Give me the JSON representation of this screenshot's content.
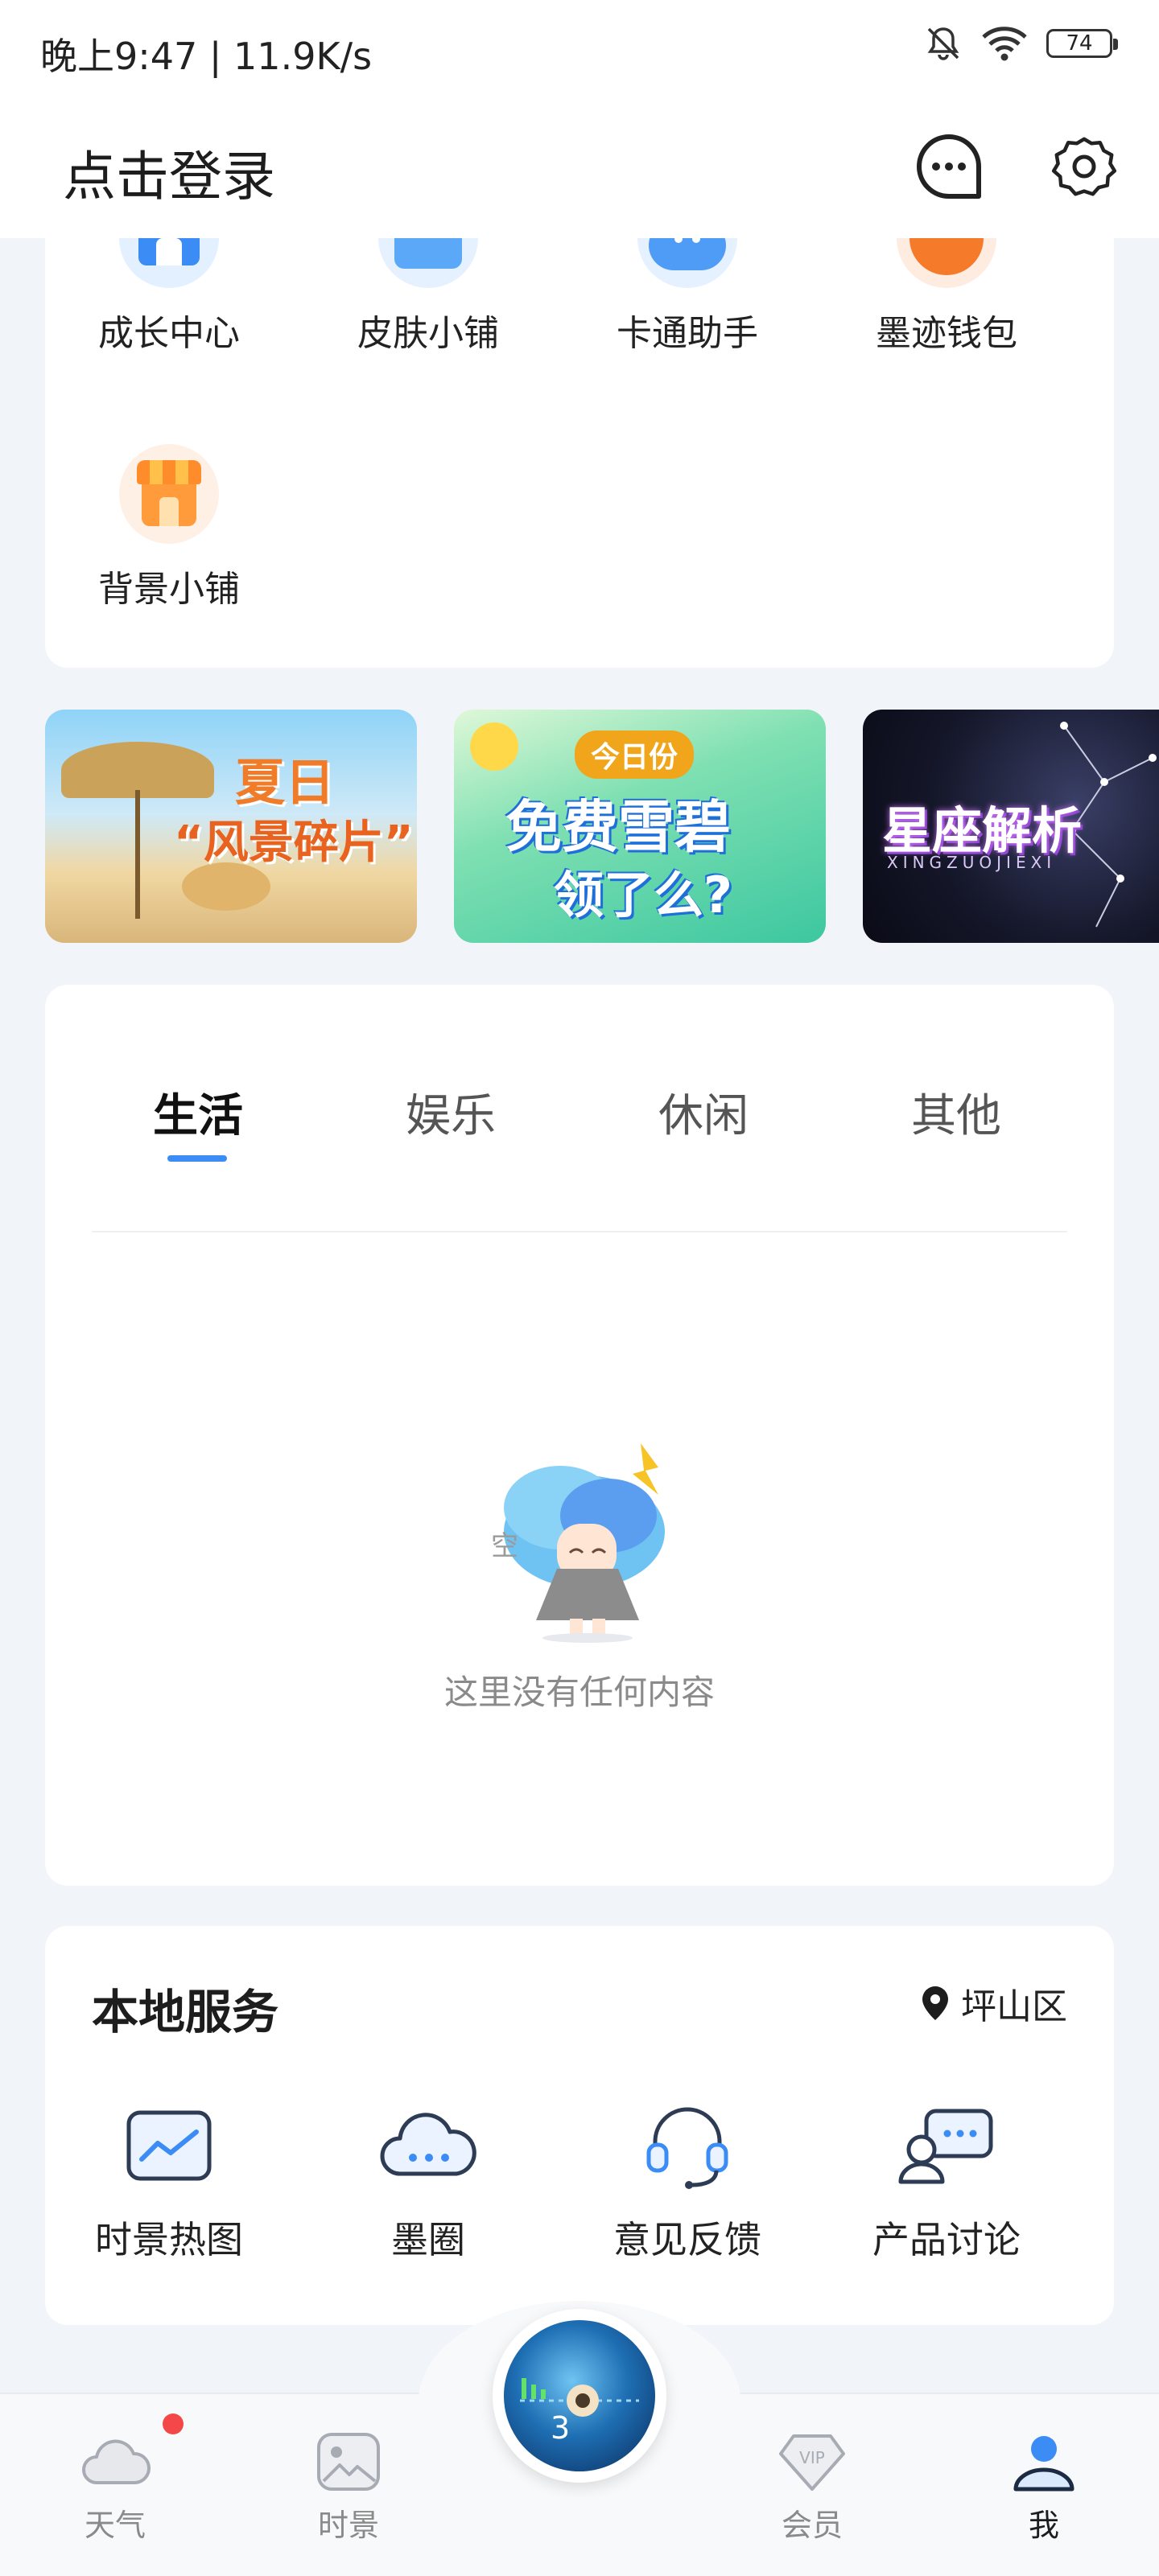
{
  "status_bar": {
    "time": "晚上9:47 | 11.9K/s",
    "battery": "74"
  },
  "header": {
    "login": "点击登录",
    "message_icon": "message-icon",
    "settings_icon": "gear-icon"
  },
  "tools": [
    {
      "label": "成长中心",
      "icon": "growth-center-icon"
    },
    {
      "label": "皮肤小铺",
      "icon": "skin-shop-icon"
    },
    {
      "label": "卡通助手",
      "icon": "cartoon-assistant-icon"
    },
    {
      "label": "墨迹钱包",
      "icon": "wallet-icon"
    },
    {
      "label": "背景小铺",
      "icon": "background-shop-icon"
    }
  ],
  "banners": [
    {
      "line1": "夏日",
      "line2": "“风景碎片”"
    },
    {
      "badge": "今日份",
      "line1": "免费雪碧",
      "line2": "领了么?"
    },
    {
      "line1": "星座解析",
      "line2": "XINGZUOJIEXI"
    }
  ],
  "tabs": [
    {
      "label": "生活",
      "active": true
    },
    {
      "label": "娱乐",
      "active": false
    },
    {
      "label": "休闲",
      "active": false
    },
    {
      "label": "其他",
      "active": false
    }
  ],
  "empty": {
    "bubble": "空",
    "text": "这里没有任何内容"
  },
  "local_services": {
    "title": "本地服务",
    "location": "坪山区",
    "items": [
      {
        "label": "时景热图",
        "icon": "image-heatmap-icon"
      },
      {
        "label": "墨圈",
        "icon": "cloud-chat-icon"
      },
      {
        "label": "意见反馈",
        "icon": "headset-icon"
      },
      {
        "label": "产品讨论",
        "icon": "discussion-icon"
      }
    ]
  },
  "bottom_nav": {
    "items": [
      {
        "label": "天气",
        "icon": "cloud-icon",
        "active": false
      },
      {
        "label": "时景",
        "icon": "picture-icon",
        "active": false
      },
      {
        "label": "会员",
        "icon": "vip-icon",
        "active": false
      },
      {
        "label": "我",
        "icon": "user-icon",
        "active": true
      }
    ],
    "center_count": "3"
  },
  "colors": {
    "accent": "#3b8cf5",
    "badge_red": "#f44848",
    "background": "#f1f4f9"
  }
}
